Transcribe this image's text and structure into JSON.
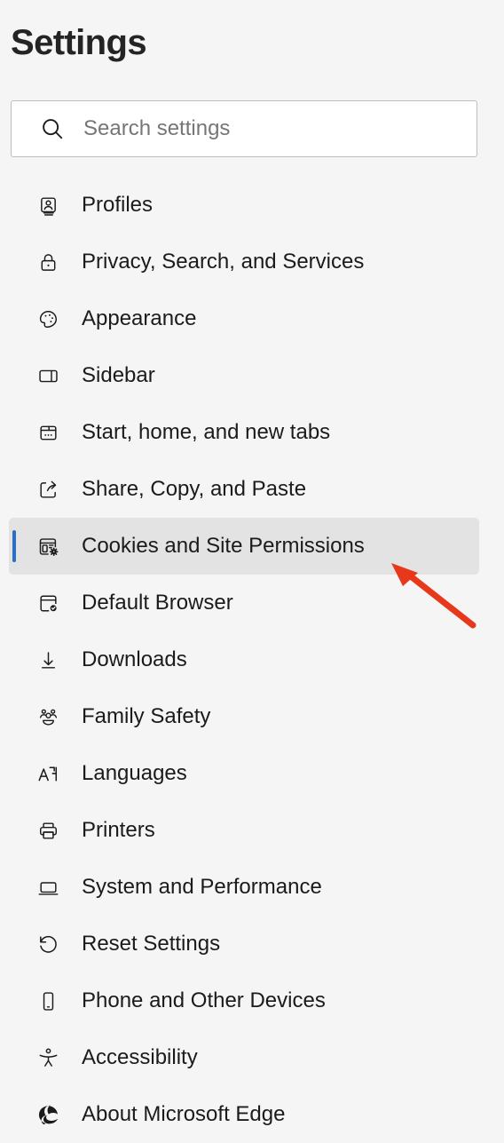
{
  "header": {
    "title": "Settings"
  },
  "search": {
    "name": "search-input",
    "value": "",
    "placeholder": "Search settings",
    "icon": "search-icon"
  },
  "colors": {
    "page_background": "#f5f5f5",
    "selected_row_background": "#e3e3e3",
    "selected_indicator": "#2e6fc4",
    "annotation_arrow": "#e8381b",
    "text": "#1b1b1b",
    "placeholder_text": "#767676",
    "search_border": "#bdbdbd"
  },
  "nav": {
    "selected_index": 6,
    "items": [
      {
        "label": "Profiles",
        "icon": "profiles-icon",
        "selected": false
      },
      {
        "label": "Privacy, Search, and Services",
        "icon": "lock-icon",
        "selected": false
      },
      {
        "label": "Appearance",
        "icon": "palette-icon",
        "selected": false
      },
      {
        "label": "Sidebar",
        "icon": "sidebar-icon",
        "selected": false
      },
      {
        "label": "Start, home, and new tabs",
        "icon": "browser-window-icon",
        "selected": false
      },
      {
        "label": "Share, Copy, and Paste",
        "icon": "share-icon",
        "selected": false
      },
      {
        "label": "Cookies and Site Permissions",
        "icon": "cookies-gear-icon",
        "selected": true
      },
      {
        "label": "Default Browser",
        "icon": "default-browser-check-icon",
        "selected": false
      },
      {
        "label": "Downloads",
        "icon": "download-arrow-icon",
        "selected": false
      },
      {
        "label": "Family Safety",
        "icon": "family-people-icon",
        "selected": false
      },
      {
        "label": "Languages",
        "icon": "languages-icon",
        "selected": false
      },
      {
        "label": "Printers",
        "icon": "printer-icon",
        "selected": false
      },
      {
        "label": "System and Performance",
        "icon": "laptop-icon",
        "selected": false
      },
      {
        "label": "Reset Settings",
        "icon": "reset-arrow-icon",
        "selected": false
      },
      {
        "label": "Phone and Other Devices",
        "icon": "phone-icon",
        "selected": false
      },
      {
        "label": "Accessibility",
        "icon": "accessibility-person-icon",
        "selected": false
      },
      {
        "label": "About Microsoft Edge",
        "icon": "edge-logo-icon",
        "selected": false
      }
    ]
  },
  "annotation": {
    "type": "arrow",
    "points_to": "Cookies and Site Permissions",
    "color": "#e8381b"
  }
}
